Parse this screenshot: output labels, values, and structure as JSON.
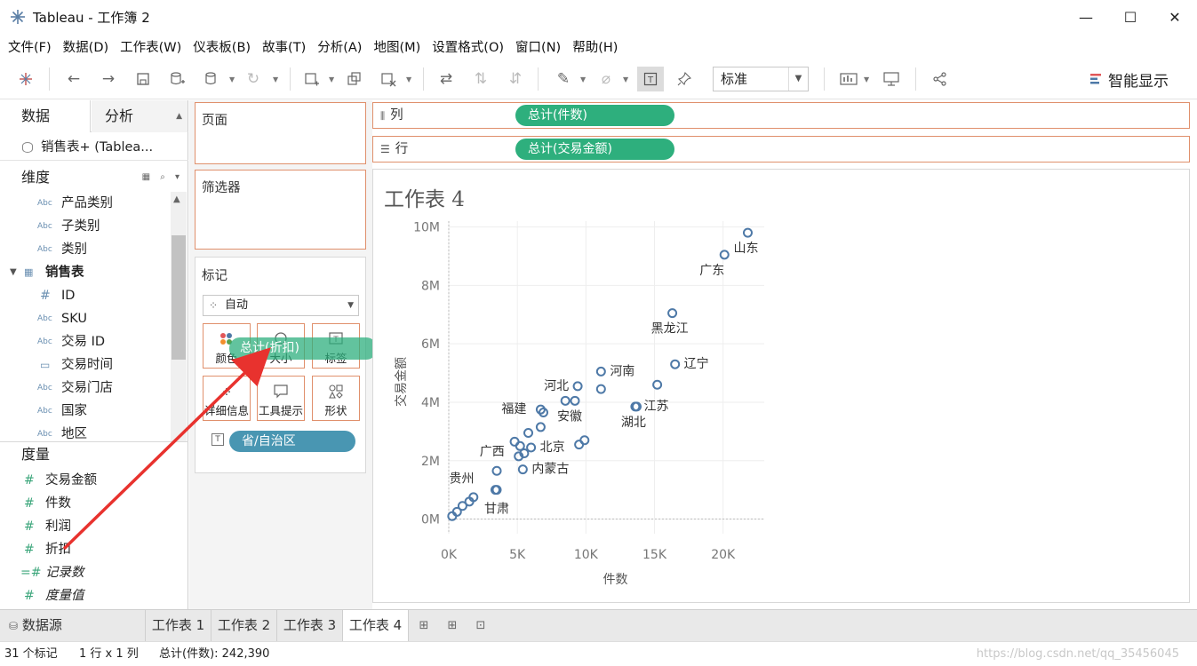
{
  "window": {
    "title": "Tableau - 工作簿 2",
    "minimize": "—",
    "maximize": "☐",
    "close": "✕"
  },
  "menu": [
    "文件(F)",
    "数据(D)",
    "工作表(W)",
    "仪表板(B)",
    "故事(T)",
    "分析(A)",
    "地图(M)",
    "设置格式(O)",
    "窗口(N)",
    "帮助(H)"
  ],
  "toolbar": {
    "fit": "标准",
    "show_me": "智能显示"
  },
  "left_pane": {
    "tab_data": "数据",
    "tab_analysis": "分析",
    "datasource": "销售表+ (Tablea...",
    "dimensions_title": "维度",
    "dimensions": [
      {
        "type": "Abc",
        "name": "产品类别"
      },
      {
        "type": "Abc",
        "name": "子类别"
      },
      {
        "type": "Abc",
        "name": "类别"
      },
      {
        "type": "table",
        "name": "销售表"
      },
      {
        "type": "#",
        "name": "ID"
      },
      {
        "type": "Abc",
        "name": "SKU"
      },
      {
        "type": "Abc",
        "name": "交易 ID"
      },
      {
        "type": "date",
        "name": "交易时间"
      },
      {
        "type": "Abc",
        "name": "交易门店"
      },
      {
        "type": "Abc",
        "name": "国家"
      },
      {
        "type": "Abc",
        "name": "地区"
      }
    ],
    "measures_title": "度量",
    "measures": [
      {
        "name": "交易金额"
      },
      {
        "name": "件数"
      },
      {
        "name": "利润"
      },
      {
        "name": "折扣"
      },
      {
        "name": "记录数"
      },
      {
        "name": "度量值"
      }
    ]
  },
  "cards": {
    "pages": "页面",
    "filters": "筛选器",
    "marks": "标记",
    "mark_type": "自动",
    "buttons": [
      "颜色",
      "大小",
      "标签",
      "详细信息",
      "工具提示",
      "形状"
    ],
    "label_pill": "省/自治区",
    "drag_pill": "总计(折扣)"
  },
  "shelves": {
    "columns_label": "列",
    "columns_pill": "总计(件数)",
    "rows_label": "行",
    "rows_pill": "总计(交易金额)"
  },
  "sheet_title": "工作表 4",
  "chart_data": {
    "type": "scatter",
    "xlabel": "件数",
    "ylabel": "交易金额",
    "xlim": [
      0,
      23000
    ],
    "ylim": [
      -500000,
      10200000
    ],
    "xticks": [
      0,
      5000,
      10000,
      15000,
      20000
    ],
    "xtick_labels": [
      "0K",
      "5K",
      "10K",
      "15K",
      "20K"
    ],
    "yticks": [
      0,
      2000000,
      4000000,
      6000000,
      8000000,
      10000000
    ],
    "ytick_labels": [
      "0M",
      "2M",
      "4M",
      "6M",
      "8M",
      "10M"
    ],
    "grid": true,
    "color": "#4e79a7",
    "points": [
      {
        "x": 21800,
        "y": 9800000,
        "label": "山东"
      },
      {
        "x": 20100,
        "y": 9050000,
        "label": "广东"
      },
      {
        "x": 16300,
        "y": 7050000,
        "label": "黑龙江"
      },
      {
        "x": 16500,
        "y": 5300000,
        "label": "辽宁"
      },
      {
        "x": 15200,
        "y": 4600000,
        "label": ""
      },
      {
        "x": 11100,
        "y": 5050000,
        "label": "河南"
      },
      {
        "x": 11100,
        "y": 4450000,
        "label": ""
      },
      {
        "x": 9400,
        "y": 4550000,
        "label": "河北"
      },
      {
        "x": 9200,
        "y": 4050000,
        "label": "安徽"
      },
      {
        "x": 8500,
        "y": 4050000,
        "label": ""
      },
      {
        "x": 13600,
        "y": 3850000,
        "label": "湖北"
      },
      {
        "x": 13700,
        "y": 3850000,
        "label": "江苏"
      },
      {
        "x": 6700,
        "y": 3750000,
        "label": "福建"
      },
      {
        "x": 6900,
        "y": 3650000,
        "label": ""
      },
      {
        "x": 6700,
        "y": 3150000,
        "label": ""
      },
      {
        "x": 5800,
        "y": 2950000,
        "label": ""
      },
      {
        "x": 9900,
        "y": 2700000,
        "label": ""
      },
      {
        "x": 9500,
        "y": 2550000,
        "label": ""
      },
      {
        "x": 4800,
        "y": 2650000,
        "label": ""
      },
      {
        "x": 5200,
        "y": 2500000,
        "label": ""
      },
      {
        "x": 6000,
        "y": 2450000,
        "label": "北京"
      },
      {
        "x": 5500,
        "y": 2250000,
        "label": ""
      },
      {
        "x": 5100,
        "y": 2150000,
        "label": "广西"
      },
      {
        "x": 5400,
        "y": 1700000,
        "label": "内蒙古"
      },
      {
        "x": 3500,
        "y": 1650000,
        "label": ""
      },
      {
        "x": 3400,
        "y": 1000000,
        "label": "贵州"
      },
      {
        "x": 3500,
        "y": 1000000,
        "label": "甘肃"
      },
      {
        "x": 1800,
        "y": 750000,
        "label": ""
      },
      {
        "x": 1500,
        "y": 600000,
        "label": ""
      },
      {
        "x": 1000,
        "y": 450000,
        "label": ""
      },
      {
        "x": 600,
        "y": 250000,
        "label": ""
      },
      {
        "x": 250,
        "y": 100000,
        "label": ""
      }
    ]
  },
  "bottom_tabs": {
    "datasource": "数据源",
    "sheets": [
      "工作表 1",
      "工作表 2",
      "工作表 3",
      "工作表 4"
    ]
  },
  "status": {
    "marks": "31 个标记",
    "dims": "1 行 x 1 列",
    "sum": "总计(件数): 242,390",
    "watermark": "https://blog.csdn.net/qq_35456045"
  }
}
